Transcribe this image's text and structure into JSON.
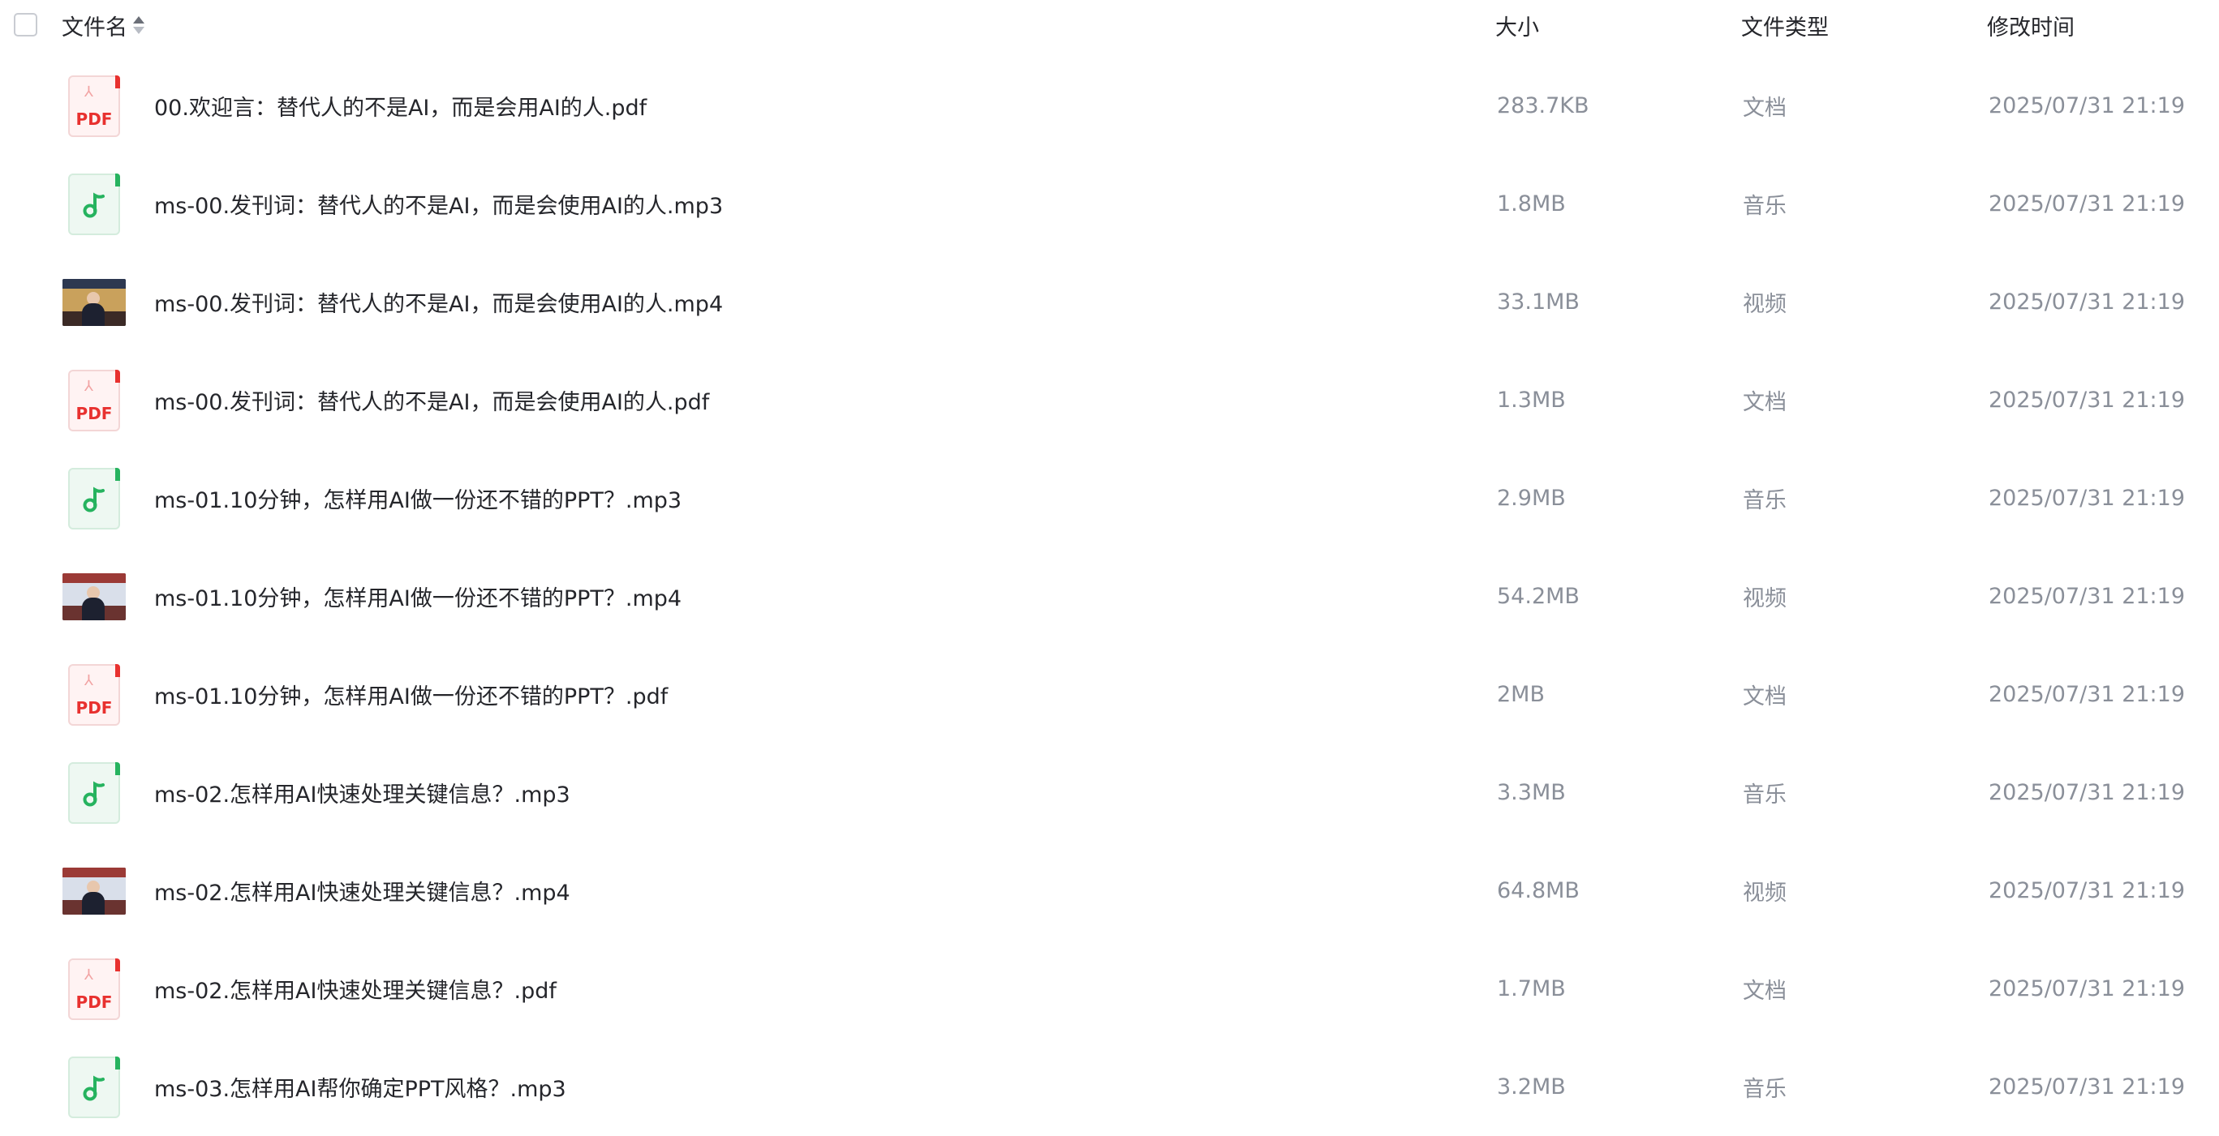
{
  "header": {
    "name_label": "文件名",
    "size_label": "大小",
    "type_label": "文件类型",
    "mtime_label": "修改时间"
  },
  "colors": {
    "pdf_red": "#e8312f",
    "music_green": "#26b35f",
    "muted_text": "#8a8f99",
    "primary_text": "#25262b"
  },
  "files": [
    {
      "icon": "pdf-icon",
      "name": "00.欢迎言：替代人的不是AI，而是会用AI的人.pdf",
      "size": "283.7KB",
      "type": "文档",
      "mtime": "2025/07/31 21:19"
    },
    {
      "icon": "music-file-icon",
      "name": "ms-00.发刊词：替代人的不是AI，而是会使用AI的人.mp3",
      "size": "1.8MB",
      "type": "音乐",
      "mtime": "2025/07/31 21:19"
    },
    {
      "icon": "video-thumbnail",
      "name": "ms-00.发刊词：替代人的不是AI，而是会使用AI的人.mp4",
      "size": "33.1MB",
      "type": "视频",
      "mtime": "2025/07/31 21:19"
    },
    {
      "icon": "pdf-icon",
      "name": "ms-00.发刊词：替代人的不是AI，而是会使用AI的人.pdf",
      "size": "1.3MB",
      "type": "文档",
      "mtime": "2025/07/31 21:19"
    },
    {
      "icon": "music-file-icon",
      "name": "ms-01.10分钟，怎样用AI做一份还不错的PPT？.mp3",
      "size": "2.9MB",
      "type": "音乐",
      "mtime": "2025/07/31 21:19"
    },
    {
      "icon": "video-thumbnail",
      "name": "ms-01.10分钟，怎样用AI做一份还不错的PPT？.mp4",
      "size": "54.2MB",
      "type": "视频",
      "mtime": "2025/07/31 21:19"
    },
    {
      "icon": "pdf-icon",
      "name": "ms-01.10分钟，怎样用AI做一份还不错的PPT？.pdf",
      "size": "2MB",
      "type": "文档",
      "mtime": "2025/07/31 21:19"
    },
    {
      "icon": "music-file-icon",
      "name": "ms-02.怎样用AI快速处理关键信息？.mp3",
      "size": "3.3MB",
      "type": "音乐",
      "mtime": "2025/07/31 21:19"
    },
    {
      "icon": "video-thumbnail",
      "name": "ms-02.怎样用AI快速处理关键信息？.mp4",
      "size": "64.8MB",
      "type": "视频",
      "mtime": "2025/07/31 21:19"
    },
    {
      "icon": "pdf-icon",
      "name": "ms-02.怎样用AI快速处理关键信息？.pdf",
      "size": "1.7MB",
      "type": "文档",
      "mtime": "2025/07/31 21:19"
    },
    {
      "icon": "music-file-icon",
      "name": "ms-03.怎样用AI帮你确定PPT风格？.mp3",
      "size": "3.2MB",
      "type": "音乐",
      "mtime": "2025/07/31 21:19"
    }
  ]
}
